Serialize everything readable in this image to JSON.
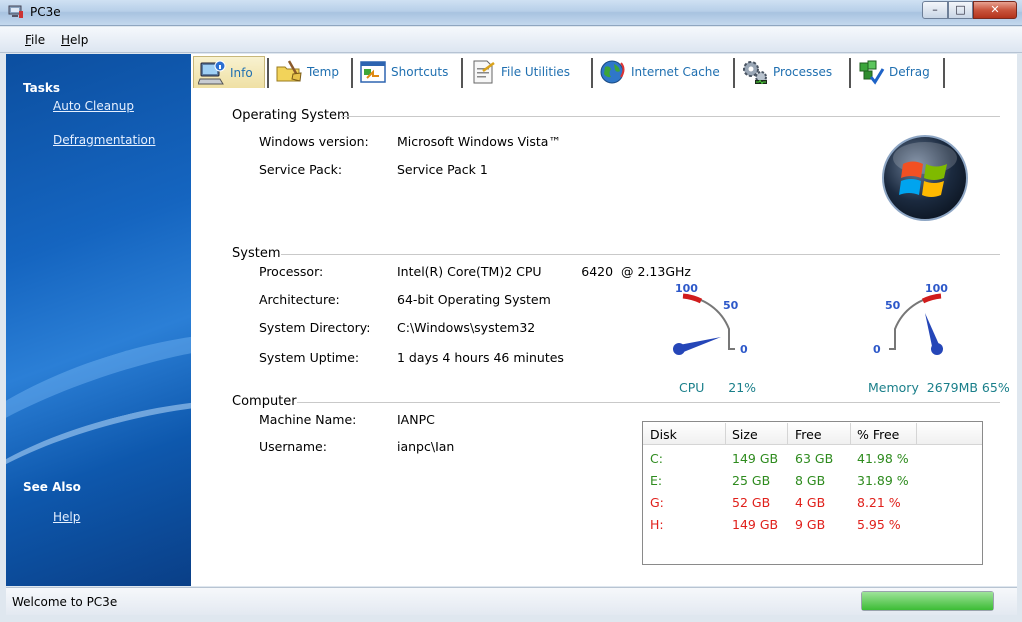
{
  "window": {
    "title": "PC3e"
  },
  "menu": [
    {
      "label": "File",
      "accel": "F",
      "rest": "ile"
    },
    {
      "label": "Help",
      "accel": "H",
      "rest": "elp"
    }
  ],
  "sidebar": {
    "tasks_heading": "Tasks",
    "tasks": [
      "Auto Cleanup",
      "Defragmentation"
    ],
    "see_also_heading": "See Also",
    "see_also": [
      "Help"
    ]
  },
  "tabs": [
    {
      "label": "Info",
      "icon": "computer-info-icon",
      "active": true
    },
    {
      "label": "Temp",
      "icon": "broom-folder-icon"
    },
    {
      "label": "Shortcuts",
      "icon": "shortcut-window-icon"
    },
    {
      "label": "File Utilities",
      "icon": "file-document-icon"
    },
    {
      "label": "Internet Cache",
      "icon": "globe-icon"
    },
    {
      "label": "Processes",
      "icon": "gears-icon"
    },
    {
      "label": "Defrag",
      "icon": "blocks-check-icon"
    }
  ],
  "info": {
    "os_section": "Operating System",
    "os": [
      {
        "label": "Windows version:",
        "value": "Microsoft Windows Vista™"
      },
      {
        "label": "Service Pack:",
        "value": "Service Pack 1"
      }
    ],
    "system_section": "System",
    "system": [
      {
        "label": "Processor:",
        "value": "Intel(R) Core(TM)2 CPU          6420  @ 2.13GHz"
      },
      {
        "label": "Architecture:",
        "value": "64-bit Operating System"
      },
      {
        "label": "System Directory:",
        "value": "C:\\Windows\\system32"
      },
      {
        "label": "System Uptime:",
        "value": "1 days 4 hours 46 minutes"
      }
    ],
    "computer_section": "Computer",
    "computer": [
      {
        "label": "Machine Name:",
        "value": "IANPC"
      },
      {
        "label": "Username:",
        "value": "ianpc\\Ian"
      }
    ]
  },
  "gauges": {
    "cpu": {
      "caption": "CPU      21%",
      "value": 21,
      "max": 100,
      "marks": [
        "100",
        "50",
        "0"
      ]
    },
    "memory": {
      "caption": "Memory  2679MB 65%",
      "value": 65,
      "max": 100,
      "marks": [
        "50",
        "100",
        "0"
      ]
    }
  },
  "disks": {
    "headers": [
      "Disk",
      "Size",
      "Free",
      "% Free"
    ],
    "rows": [
      {
        "cells": [
          "C:",
          "149 GB",
          "63 GB",
          "41.98 %"
        ],
        "color": "#2e8b1e"
      },
      {
        "cells": [
          "E:",
          "25 GB",
          "8 GB",
          "31.89 %"
        ],
        "color": "#2e8b1e"
      },
      {
        "cells": [
          "G:",
          "52 GB",
          "4 GB",
          "8.21 %"
        ],
        "color": "#e0201b"
      },
      {
        "cells": [
          "H:",
          "149 GB",
          "9 GB",
          "5.95 %"
        ],
        "color": "#e0201b"
      }
    ]
  },
  "status": {
    "text": "Welcome to PC3e",
    "progress": 1.0
  },
  "colors": {
    "link": "#1f6fb0",
    "gauge_text": "#1a7f8a",
    "ok": "#2e8b1e",
    "warn": "#e0201b"
  }
}
